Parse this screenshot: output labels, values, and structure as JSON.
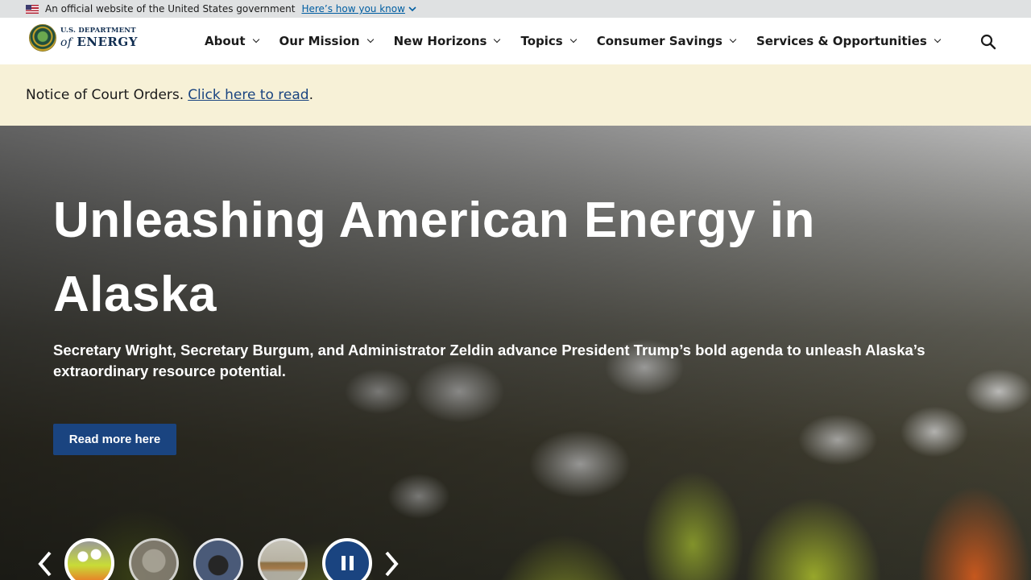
{
  "gov_banner": {
    "text": "An official website of the United States government",
    "link": "Here’s how you know"
  },
  "logo": {
    "line1": "U.S. DEPARTMENT",
    "line2_prefix": "of",
    "line2": "ENERGY"
  },
  "nav": {
    "items": [
      {
        "label": "About"
      },
      {
        "label": "Our Mission"
      },
      {
        "label": "New Horizons"
      },
      {
        "label": "Topics"
      },
      {
        "label": "Consumer Savings"
      },
      {
        "label": "Services & Opportunities"
      }
    ],
    "search_icon": "search-icon"
  },
  "notice": {
    "label": "Notice of Court Orders.",
    "link": "Click here to read",
    "suffix": "."
  },
  "hero": {
    "title": "Unleashing American Energy in Alaska",
    "subtitle": "Secretary Wright, Secretary Burgum, and Administrator Zeldin advance President Trump’s bold agenda to unleash Alaska’s extraordinary resource potential.",
    "button": "Read more here"
  },
  "carousel": {
    "prev_icon": "chevron-left-icon",
    "next_icon": "chevron-right-icon",
    "pause_icon": "pause-icon",
    "slide_count": 4,
    "active_slide": 1
  }
}
